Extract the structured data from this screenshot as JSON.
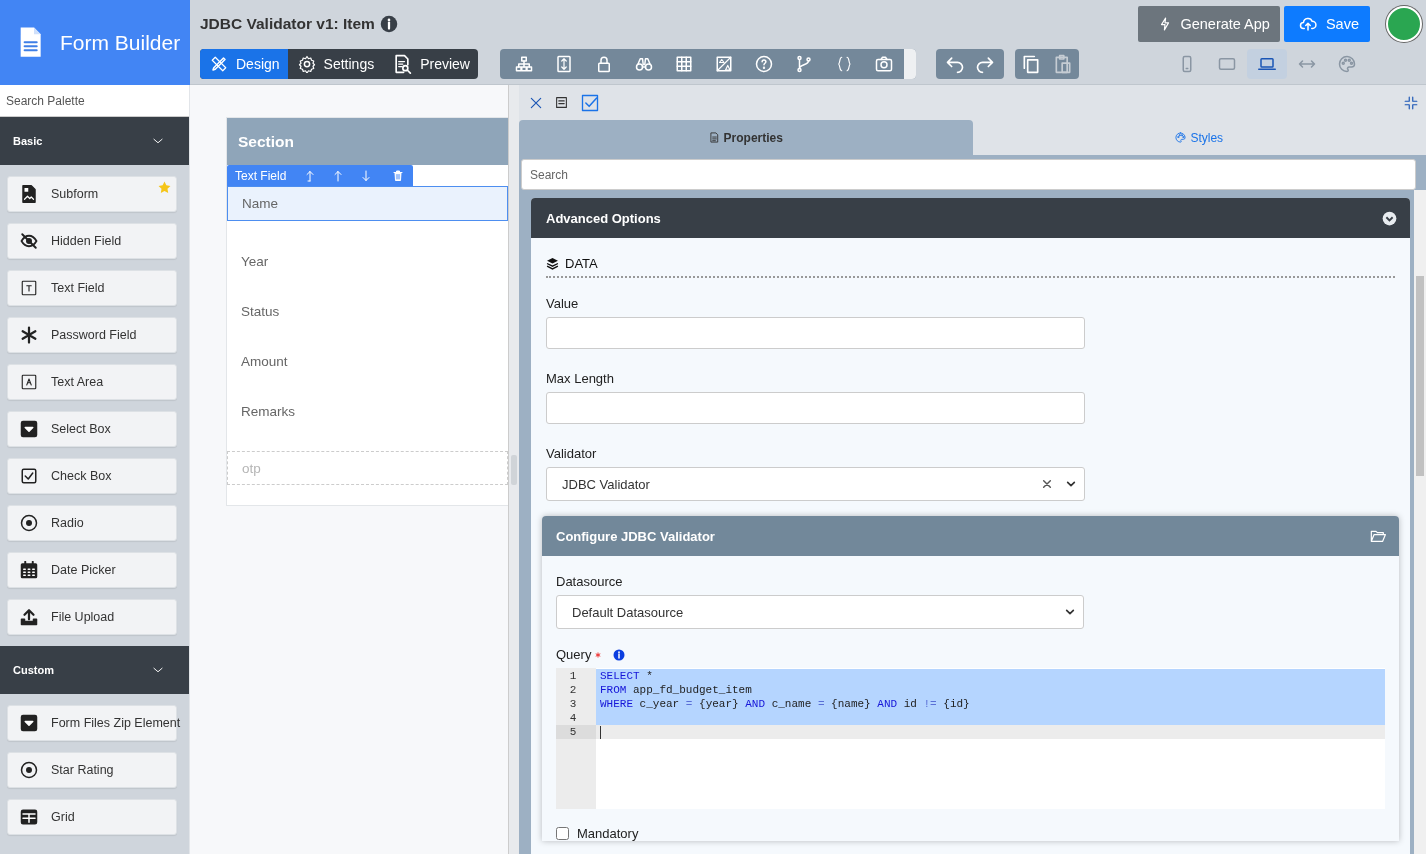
{
  "app": {
    "title": "Form Builder"
  },
  "palette": {
    "search": {
      "placeholder": "Search Palette"
    },
    "groups": [
      {
        "title": "Basic",
        "expanded": true,
        "items": [
          {
            "label": "Subform",
            "kind": "subform",
            "favorite": true
          },
          {
            "label": "Hidden Field",
            "kind": "hidden",
            "favorite": false
          },
          {
            "label": "Text Field",
            "kind": "text",
            "favorite": false
          },
          {
            "label": "Password Field",
            "kind": "password",
            "favorite": false
          },
          {
            "label": "Text Area",
            "kind": "textarea",
            "favorite": false
          },
          {
            "label": "Select Box",
            "kind": "select",
            "favorite": false
          },
          {
            "label": "Check Box",
            "kind": "checkbox",
            "favorite": false
          },
          {
            "label": "Radio",
            "kind": "radio",
            "favorite": false
          },
          {
            "label": "Date Picker",
            "kind": "date",
            "favorite": false
          },
          {
            "label": "File Upload",
            "kind": "upload",
            "favorite": false
          }
        ]
      },
      {
        "title": "Custom",
        "expanded": true,
        "items": [
          {
            "label": "Form Files Zip Element",
            "kind": "select",
            "favorite": false
          },
          {
            "label": "Star Rating",
            "kind": "radio",
            "favorite": false
          },
          {
            "label": "Grid",
            "kind": "grid",
            "favorite": false
          }
        ]
      }
    ]
  },
  "header": {
    "title": "JDBC Validator v1: Item",
    "modes": [
      {
        "label": "Design",
        "kind": "design",
        "selected": true
      },
      {
        "label": "Settings",
        "kind": "settings",
        "selected": false
      },
      {
        "label": "Preview",
        "kind": "preview",
        "selected": false
      }
    ],
    "devices": [
      {
        "kind": "phone",
        "selected": false
      },
      {
        "kind": "tablet",
        "selected": false
      },
      {
        "kind": "laptop",
        "selected": true
      },
      {
        "kind": "fluid",
        "selected": false
      },
      {
        "kind": "theme",
        "selected": false
      }
    ],
    "buttons": [
      {
        "label": "Generate App",
        "kind": "generate"
      },
      {
        "label": "Save",
        "kind": "save"
      }
    ]
  },
  "canvas": {
    "section": {
      "title": "Section",
      "toolbar": {
        "label": "Text Field"
      },
      "fields": [
        {
          "label": "Name",
          "kind": "field",
          "selected": true
        },
        {
          "label": "Year",
          "kind": "field",
          "selected": false
        },
        {
          "label": "Status",
          "kind": "field",
          "selected": false
        },
        {
          "label": "Amount",
          "kind": "field",
          "selected": false
        },
        {
          "label": "Remarks",
          "kind": "field",
          "selected": false
        },
        {
          "label": "otp",
          "kind": "hidden",
          "selected": false
        }
      ]
    }
  },
  "properties": {
    "tabs": [
      {
        "label": "Properties",
        "kind": "properties",
        "selected": true
      },
      {
        "label": "Styles",
        "kind": "styles",
        "selected": false
      }
    ],
    "search": {
      "placeholder": "Search"
    },
    "panel": {
      "title": "Advanced Options",
      "expanded": true,
      "section": "DATA",
      "fields": [
        {
          "label": "Value",
          "kind": "text"
        },
        {
          "label": "Max Length",
          "kind": "text"
        },
        {
          "label": "Validator",
          "kind": "select",
          "value": "JDBC Validator",
          "clearable": true
        }
      ],
      "subpanel": {
        "title": "Configure JDBC Validator",
        "datasource": {
          "label": "Datasource",
          "value": "Default Datasource"
        },
        "query": {
          "label": "Query",
          "required": true,
          "lines": [
            {
              "number": "1",
              "selected": true,
              "active": false,
              "tokens": [
                {
                  "kind": "keyword",
                  "text": "SELECT"
                },
                {
                  "kind": "plain",
                  "text": " *"
                }
              ]
            },
            {
              "number": "2",
              "selected": true,
              "active": false,
              "tokens": [
                {
                  "kind": "keyword",
                  "text": "FROM"
                },
                {
                  "kind": "plain",
                  "text": " app_fd_budget_item"
                }
              ]
            },
            {
              "number": "3",
              "selected": true,
              "active": false,
              "tokens": [
                {
                  "kind": "keyword",
                  "text": "WHERE"
                },
                {
                  "kind": "plain",
                  "text": " c_year "
                },
                {
                  "kind": "operator",
                  "text": "="
                },
                {
                  "kind": "plain",
                  "text": " {year} "
                },
                {
                  "kind": "keyword",
                  "text": "AND"
                },
                {
                  "kind": "plain",
                  "text": " c_name "
                },
                {
                  "kind": "operator",
                  "text": "="
                },
                {
                  "kind": "plain",
                  "text": " {name} "
                },
                {
                  "kind": "keyword",
                  "text": "AND"
                },
                {
                  "kind": "plain",
                  "text": " id "
                },
                {
                  "kind": "operator",
                  "text": "!="
                },
                {
                  "kind": "plain",
                  "text": " {id}"
                }
              ]
            },
            {
              "number": "4",
              "selected": true,
              "active": false
            },
            {
              "number": "5",
              "selected": false,
              "active": true
            }
          ]
        },
        "mandatory": {
          "label": "Mandatory",
          "checked": false
        }
      }
    }
  }
}
